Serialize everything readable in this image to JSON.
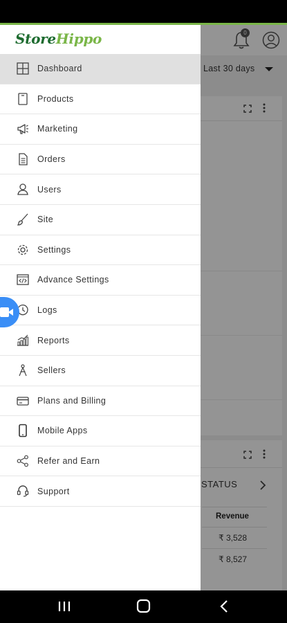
{
  "app": {
    "logo_part1": "Store",
    "logo_part2": "Hippo",
    "brand_color": "#1d6b2f",
    "accent_color": "#7ab648"
  },
  "header": {
    "notification_count": "0",
    "date_range": "Last 30 days"
  },
  "drawer": {
    "items": [
      {
        "label": "Dashboard",
        "icon": "dashboard-icon",
        "active": true
      },
      {
        "label": "Products",
        "icon": "products-icon"
      },
      {
        "label": "Marketing",
        "icon": "megaphone-icon"
      },
      {
        "label": "Orders",
        "icon": "orders-icon"
      },
      {
        "label": "Users",
        "icon": "user-icon"
      },
      {
        "label": "Site",
        "icon": "brush-icon"
      },
      {
        "label": "Settings",
        "icon": "gear-icon"
      },
      {
        "label": "Advance Settings",
        "icon": "code-icon"
      },
      {
        "label": "Logs",
        "icon": "history-icon"
      },
      {
        "label": "Reports",
        "icon": "bar-chart-icon"
      },
      {
        "label": "Sellers",
        "icon": "sellers-icon"
      },
      {
        "label": "Plans and Billing",
        "icon": "card-icon"
      },
      {
        "label": "Mobile Apps",
        "icon": "mobile-icon"
      },
      {
        "label": "Refer and Earn",
        "icon": "share-icon"
      },
      {
        "label": "Support",
        "icon": "headset-icon"
      }
    ]
  },
  "background": {
    "status_tab": "STATUS",
    "revenue_header": "Revenue",
    "revenue_values": [
      "₹ 3,528",
      "₹ 8,527"
    ]
  }
}
